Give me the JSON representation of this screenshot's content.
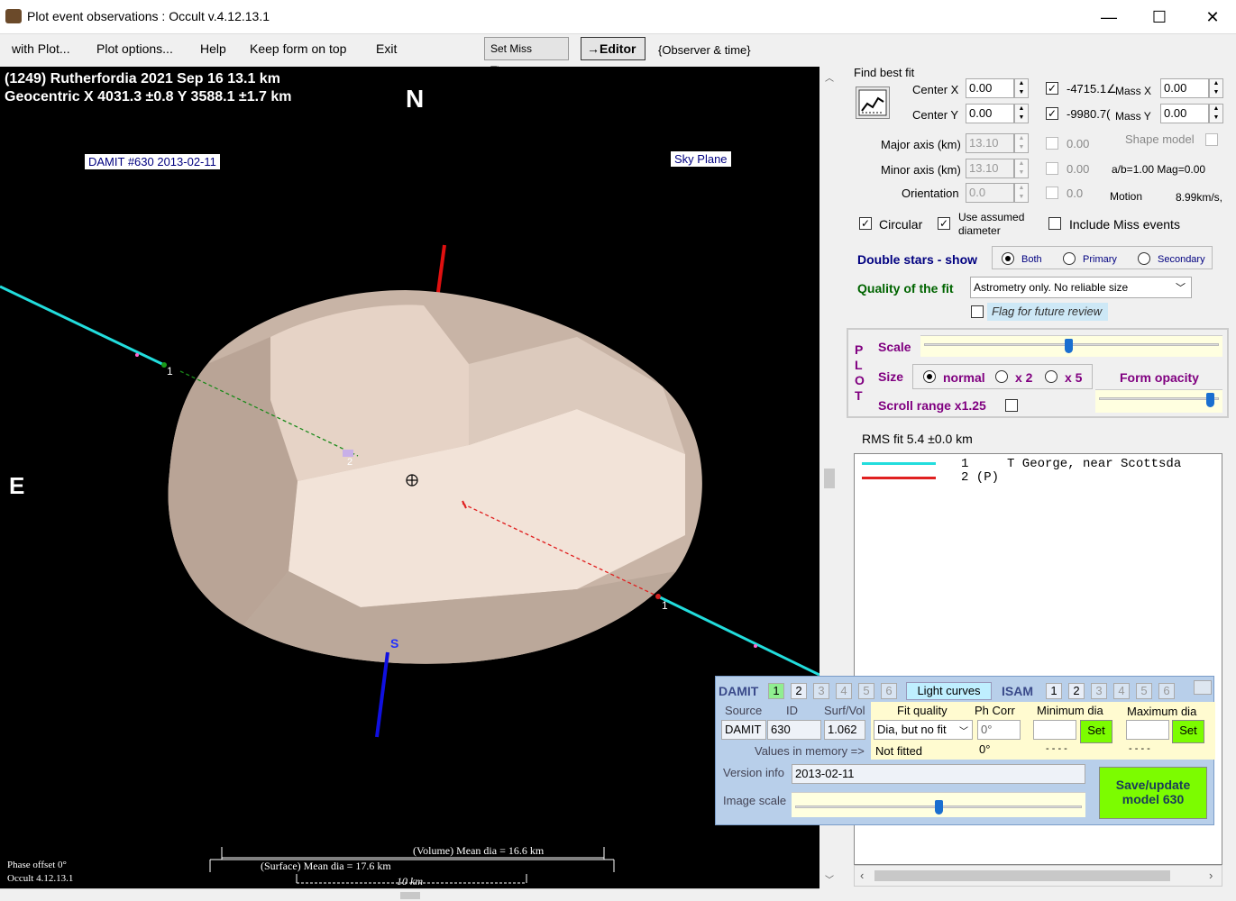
{
  "window": {
    "title": "Plot event observations : Occult v.4.12.13.1",
    "minimize": "—",
    "maximize": "☐",
    "close": "✕"
  },
  "menu": {
    "with_plot": "with Plot...",
    "plot_options": "Plot options...",
    "help": "Help",
    "keep_on_top": "Keep form on top",
    "exit": "Exit",
    "set_miss_times": "Set Miss Times",
    "editor": "→Editor",
    "observer_time": "{Observer & time}"
  },
  "plot": {
    "header_line1": "(1249) Rutherfordia  2021 Sep 16   13.1 km",
    "header_line2": "Geocentric  X  4031.3 ±0.8  Y 3588.1 ±1.7 km",
    "north": "N",
    "east": "E",
    "south": "S",
    "damit_label": "DAMIT #630 2013-02-11",
    "sky_plane": "Sky Plane",
    "chord1_a": "1",
    "chord1_b": "1",
    "chord2": "2",
    "phase_offset": "Phase offset 0°",
    "occult_version": "Occult 4.12.13.1",
    "volume_dia": "(Volume) Mean dia = 16.6 km",
    "surface_dia": "(Surface) Mean dia = 17.6 km",
    "scale_bar": "10 km"
  },
  "fit": {
    "find_best_fit": "Find best fit",
    "center_x_label": "Center X",
    "center_x": "0.00",
    "center_y_label": "Center Y",
    "center_y": "0.00",
    "val1": "-4715.1∠",
    "val2": "-9980.7(",
    "mass_x_label": "Mass X",
    "mass_x": "0.00",
    "mass_y_label": "Mass Y",
    "mass_y": "0.00",
    "major_axis_label": "Major axis (km)",
    "major_axis": "13.10",
    "minor_axis_label": "Minor axis (km)",
    "minor_axis": "13.10",
    "orientation_label": "Orientation",
    "orientation": "0.0",
    "dis1": "0.00",
    "dis2": "0.00",
    "dis3": "0.0",
    "shape_model": "Shape model",
    "ab_mag": "a/b=1.00  Mag=0.00",
    "motion_label": "Motion",
    "motion": "8.99km/s,",
    "circular": "Circular",
    "use_assumed_1": "Use assumed",
    "use_assumed_2": "diameter",
    "include_miss": "Include Miss events",
    "double_stars": "Double stars - show",
    "both": "Both",
    "primary": "Primary",
    "secondary": "Secondary",
    "quality_label": "Quality of the fit",
    "quality_value": "Astrometry only. No reliable size",
    "flag_review": "Flag for future review"
  },
  "plotctl": {
    "letters": [
      "P",
      "L",
      "O",
      "T"
    ],
    "scale": "Scale",
    "size": "Size",
    "normal": "normal",
    "x2": "x 2",
    "x5": "x 5",
    "form_opacity": "Form opacity",
    "scroll_range": "Scroll range x1.25",
    "scale_level": 0.49,
    "opacity_level": 0.96
  },
  "rms": "RMS fit 5.4 ±0.0 km",
  "observers": [
    {
      "color": "#22dddd",
      "num": "1",
      "name": "T George, near Scottsda"
    },
    {
      "color": "#e02020",
      "num": "2 (P)",
      "name": ""
    }
  ],
  "damit": {
    "damit": "DAMIT",
    "isam": "ISAM",
    "nums": [
      "1",
      "2",
      "3",
      "4",
      "5",
      "6"
    ],
    "light_curves": "Light curves",
    "source_h": "Source",
    "id_h": "ID",
    "surfvol_h": "Surf/Vol",
    "source": "DAMIT",
    "id": "630",
    "surfvol": "1.062",
    "fit_quality_h": "Fit quality",
    "fit_quality": "Dia, but no fit",
    "ph_corr_h": "Ph Corr",
    "ph_corr": "0°",
    "min_dia_h": "Minimum dia",
    "max_dia_h": "Maximum dia",
    "set": "Set",
    "values_mem": "Values in memory =>",
    "not_fitted": "Not fitted",
    "ph_mem": "0°",
    "dashes1": "- - - -",
    "dashes2": "- - - -",
    "version_info_label": "Version info",
    "version_info": "2013-02-11",
    "image_scale": "Image scale",
    "image_scale_level": 0.5,
    "save_1": "Save/update",
    "save_2": "model 630"
  }
}
